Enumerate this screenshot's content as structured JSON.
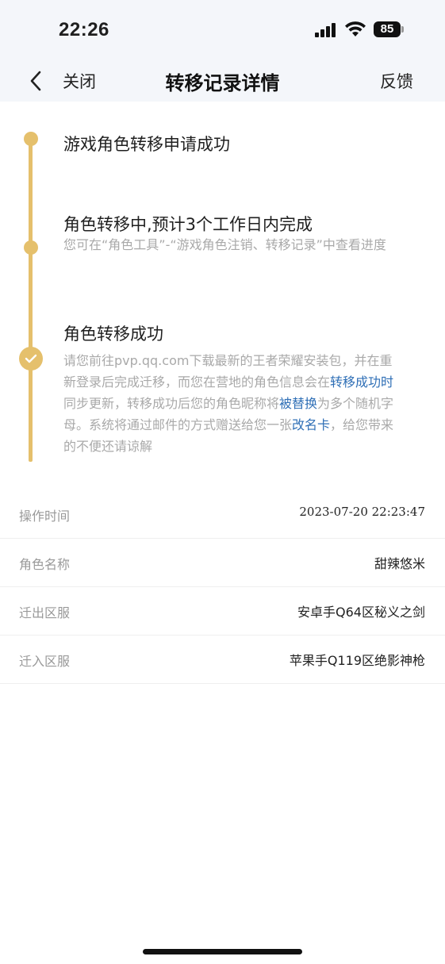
{
  "status_bar": {
    "time": "22:26",
    "battery": "85"
  },
  "nav": {
    "close_label": "关闭",
    "title": "转移记录详情",
    "feedback_label": "反馈"
  },
  "timeline": {
    "accent_color": "#e5c06c",
    "steps": [
      {
        "title": "游戏角色转移申请成功",
        "desc": ""
      },
      {
        "title": "角色转移中,预计3个工作日内完成",
        "desc": "您可在“角色工具”-“游戏角色注销、转移记录”中查看进度"
      },
      {
        "title": "角色转移成功",
        "desc_parts": [
          "请您前往pvp.qq.com下载最新的王者荣耀安装包，并在重新登录后完成迁移，而您在营地的角色信息会在",
          "转移成功时",
          "同步更新，转移成功后您的角色昵称将",
          "被替换",
          "为多个随机字母。系统将通过邮件的方式赠送给您一张",
          "改名卡",
          "，给您带来的不便还请谅解"
        ]
      }
    ]
  },
  "info": [
    {
      "label": "操作时间",
      "value": "2023-07-20 22:23:47"
    },
    {
      "label": "角色名称",
      "value": "甜辣悠米"
    },
    {
      "label": "迁出区服",
      "value": "安卓手Q64区秘义之剑"
    },
    {
      "label": "迁入区服",
      "value": "苹果手Q119区绝影神枪"
    }
  ],
  "link_color": "#2f6fb6"
}
